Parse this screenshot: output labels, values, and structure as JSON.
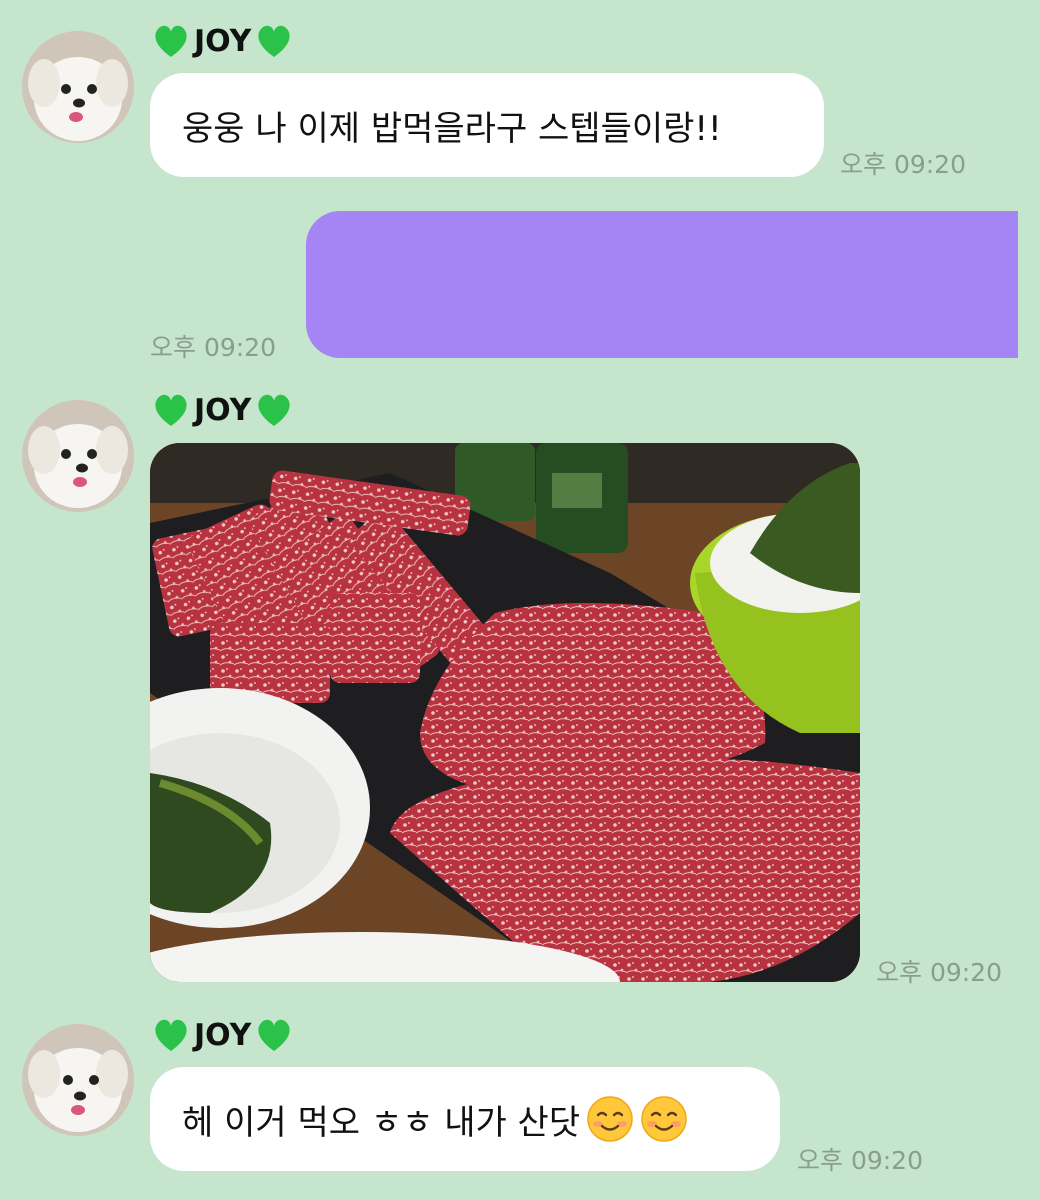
{
  "chat": {
    "messages": [
      {
        "sender": "JOY",
        "type": "text",
        "text": "웅웅 나 이제 밥먹을라구 스텝들이랑!!",
        "time": "오후 09:20"
      },
      {
        "sender": "me",
        "type": "redacted",
        "text": "",
        "time": "오후 09:20"
      },
      {
        "sender": "JOY",
        "type": "image",
        "image_description": "marbled beef on slate board",
        "time": "오후 09:20"
      },
      {
        "sender": "JOY",
        "type": "text",
        "text": "헤 이거 먹오 ㅎㅎ 내가 산닷",
        "emoji": [
          "smiling-face-icon",
          "smiling-face-icon"
        ],
        "time": "오후 09:20"
      }
    ]
  },
  "colors": {
    "background": "#c5e6cc",
    "incoming_bubble": "#ffffff",
    "outgoing_bubble": "#a584f6",
    "heart": "#2bc24a",
    "time_text": "#8a9d8f"
  },
  "icons": {
    "heart": "green-heart-icon",
    "avatar": "dog-avatar"
  }
}
